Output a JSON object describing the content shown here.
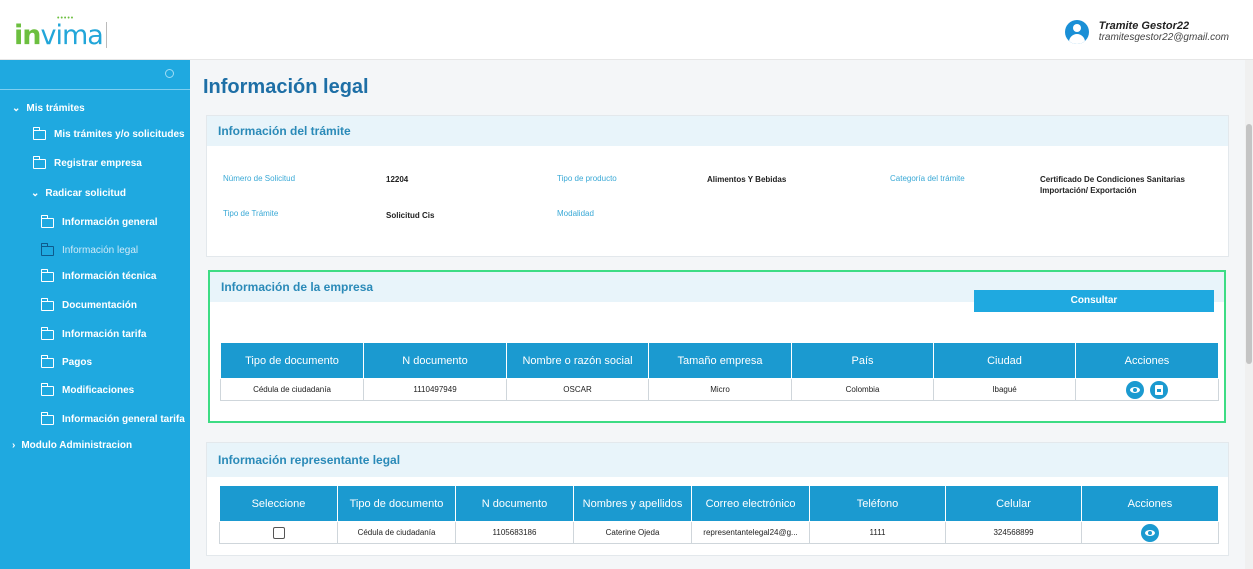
{
  "header": {
    "logo_text": "invima",
    "user_name": "Tramite Gestor22",
    "user_email": "tramitesgestor22@gmail.com"
  },
  "sidebar": {
    "mis_tramites": "Mis trámites",
    "items": [
      {
        "label": "Mis trámites y/o solicitudes"
      },
      {
        "label": "Registrar empresa"
      },
      {
        "label": "Radicar solicitud"
      },
      {
        "label": "Información general"
      },
      {
        "label": "Información legal"
      },
      {
        "label": "Información técnica"
      },
      {
        "label": "Documentación"
      },
      {
        "label": "Información tarifa"
      },
      {
        "label": "Pagos"
      },
      {
        "label": "Modificaciones"
      },
      {
        "label": "Información general tarifa"
      },
      {
        "label": "Modulo Administracion"
      }
    ]
  },
  "page": {
    "title": "Información legal"
  },
  "tramite": {
    "heading": "Información del trámite",
    "numero_label": "Número de Solicitud",
    "numero_value": "12204",
    "tipo_producto_label": "Tipo de producto",
    "tipo_producto_value": "Alimentos Y Bebidas",
    "categoria_label": "Categoría del trámite",
    "categoria_value": "Certificado De Condiciones Sanitarias Importación/ Exportación",
    "tipo_tramite_label": "Tipo de Trámite",
    "tipo_tramite_value": "Solicitud Cis",
    "modalidad_label": "Modalidad"
  },
  "empresa": {
    "heading": "Información de la empresa",
    "consultar_label": "Consultar",
    "columns": [
      "Tipo de documento",
      "N documento",
      "Nombre o razón social",
      "Tamaño empresa",
      "País",
      "Ciudad",
      "Acciones"
    ],
    "rows": [
      [
        "Cédula de ciudadanía",
        "1110497949",
        "OSCAR",
        "Micro",
        "Colombia",
        "Ibagué"
      ]
    ]
  },
  "representante": {
    "heading": "Información representante legal",
    "columns": [
      "Seleccione",
      "Tipo de documento",
      "N documento",
      "Nombres y apellidos",
      "Correo electrónico",
      "Teléfono",
      "Celular",
      "Acciones"
    ],
    "rows": [
      [
        "",
        "Cédula de ciudadanía",
        "1105683186",
        "Caterine Ojeda",
        "representantelegal24@g...",
        "1111",
        "324568899"
      ]
    ]
  },
  "colors": {
    "sidebar": "#1fa9e0",
    "table_header": "#1b9ad0",
    "highlight_border": "#3ddc84",
    "title": "#1e6fa6"
  }
}
